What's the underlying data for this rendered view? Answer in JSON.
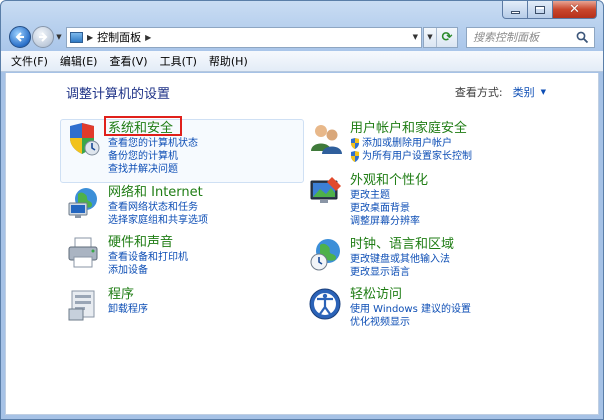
{
  "window": {
    "close_glyph": "✕"
  },
  "address_bar": {
    "path": "控制面板",
    "refresh_glyph": "⟳"
  },
  "search": {
    "placeholder": "搜索控制面板"
  },
  "menu": [
    {
      "label": "文件(F)"
    },
    {
      "label": "编辑(E)"
    },
    {
      "label": "查看(V)"
    },
    {
      "label": "工具(T)"
    },
    {
      "label": "帮助(H)"
    }
  ],
  "page": {
    "title": "调整计算机的设置",
    "view_by_label": "查看方式:",
    "view_by_value": "类别"
  },
  "categories": {
    "system": {
      "title": "系统和安全",
      "links": [
        "查看您的计算机状态",
        "备份您的计算机",
        "查找并解决问题"
      ]
    },
    "network": {
      "title": "网络和 Internet",
      "links": [
        "查看网络状态和任务",
        "选择家庭组和共享选项"
      ]
    },
    "hardware": {
      "title": "硬件和声音",
      "links": [
        "查看设备和打印机",
        "添加设备"
      ]
    },
    "programs": {
      "title": "程序",
      "links": [
        "卸载程序"
      ]
    },
    "users": {
      "title": "用户帐户和家庭安全",
      "links": [
        "添加或删除用户帐户",
        "为所有用户设置家长控制"
      ]
    },
    "appearance": {
      "title": "外观和个性化",
      "links": [
        "更改主题",
        "更改桌面背景",
        "调整屏幕分辨率"
      ]
    },
    "clock": {
      "title": "时钟、语言和区域",
      "links": [
        "更改键盘或其他输入法",
        "更改显示语言"
      ]
    },
    "ease": {
      "title": "轻松访问",
      "links": [
        "使用 Windows 建议的设置",
        "优化视频显示"
      ]
    }
  },
  "colors": {
    "category_title": "#1f7d14",
    "link": "#0d4eb5",
    "highlight": "#e0201b"
  }
}
